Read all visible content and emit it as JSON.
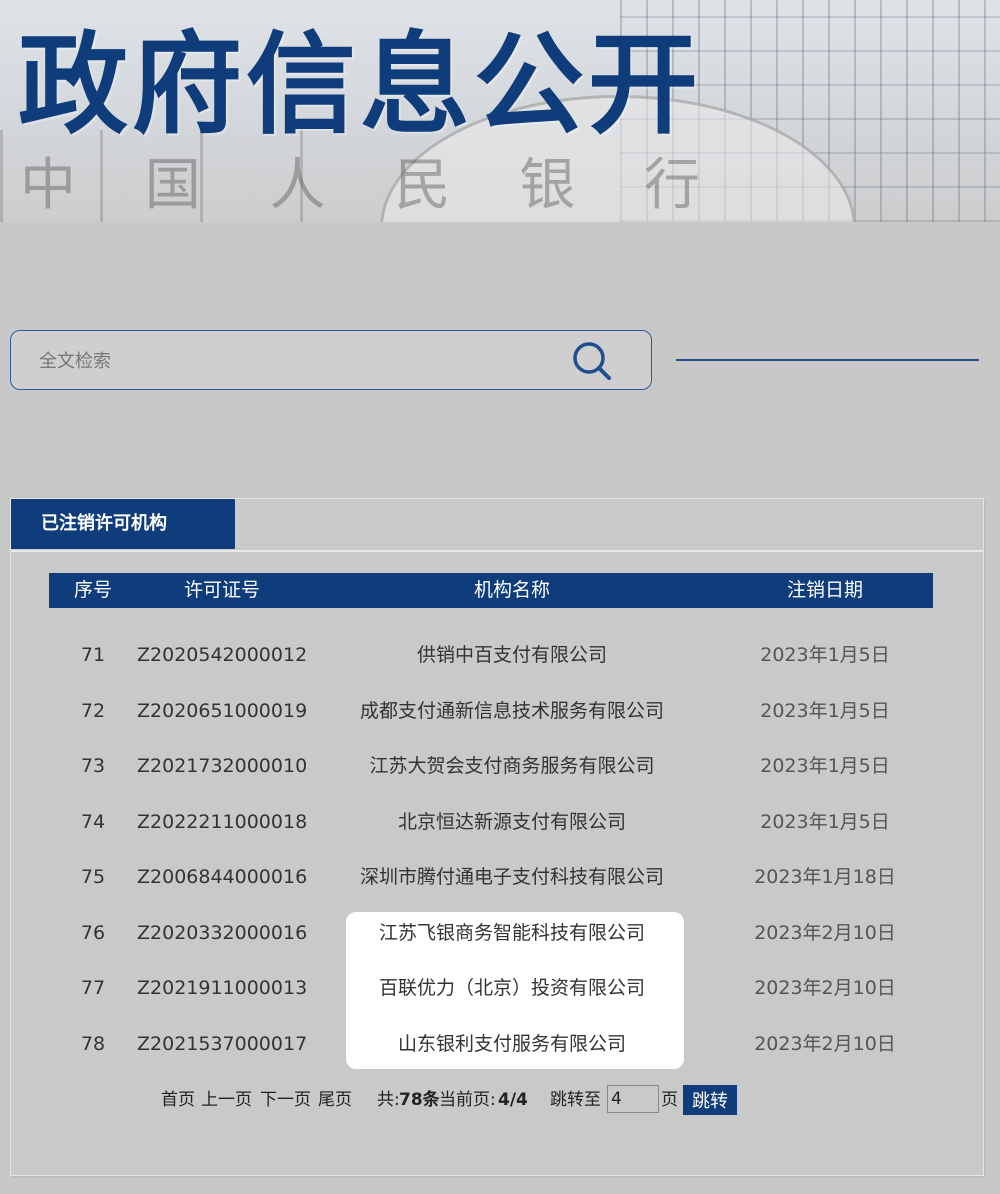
{
  "banner": {
    "title": "政府信息公开",
    "subtitle_chars": [
      "中",
      "国",
      "人",
      "民",
      "银",
      "行"
    ]
  },
  "search": {
    "placeholder": "全文检索",
    "icon": "search-icon"
  },
  "panel": {
    "tab_label": "已注销许可机构"
  },
  "table": {
    "headers": [
      "序号",
      "许可证号",
      "机构名称",
      "注销日期"
    ],
    "rows": [
      {
        "no": "71",
        "license": "Z2020542000012",
        "name": "供销中百支付有限公司",
        "date": "2023年1月5日"
      },
      {
        "no": "72",
        "license": "Z2020651000019",
        "name": "成都支付通新信息技术服务有限公司",
        "date": "2023年1月5日"
      },
      {
        "no": "73",
        "license": "Z2021732000010",
        "name": "江苏大贺会支付商务服务有限公司",
        "date": "2023年1月5日"
      },
      {
        "no": "74",
        "license": "Z2022211000018",
        "name": "北京恒达新源支付有限公司",
        "date": "2023年1月5日"
      },
      {
        "no": "75",
        "license": "Z2006844000016",
        "name": "深圳市腾付通电子支付科技有限公司",
        "date": "2023年1月18日"
      },
      {
        "no": "76",
        "license": "Z2020332000016",
        "name": "江苏飞银商务智能科技有限公司",
        "date": "2023年2月10日"
      },
      {
        "no": "77",
        "license": "Z2021911000013",
        "name": "百联优力（北京）投资有限公司",
        "date": "2023年2月10日"
      },
      {
        "no": "78",
        "license": "Z2021537000017",
        "name": "山东银利支付服务有限公司",
        "date": "2023年2月10日"
      }
    ]
  },
  "pager": {
    "first": "首页",
    "prev": "上一页",
    "next": "下一页",
    "last": "尾页",
    "total_prefix": "共:",
    "total": "78条",
    "current_prefix": "当前页:",
    "current": "4/4",
    "jump_to": "跳转至",
    "jump_value": "4",
    "page_unit": "页",
    "jump_button": "跳转"
  },
  "colors": {
    "brand_blue": "#0f3c7a",
    "background": "#c8c8c8"
  }
}
